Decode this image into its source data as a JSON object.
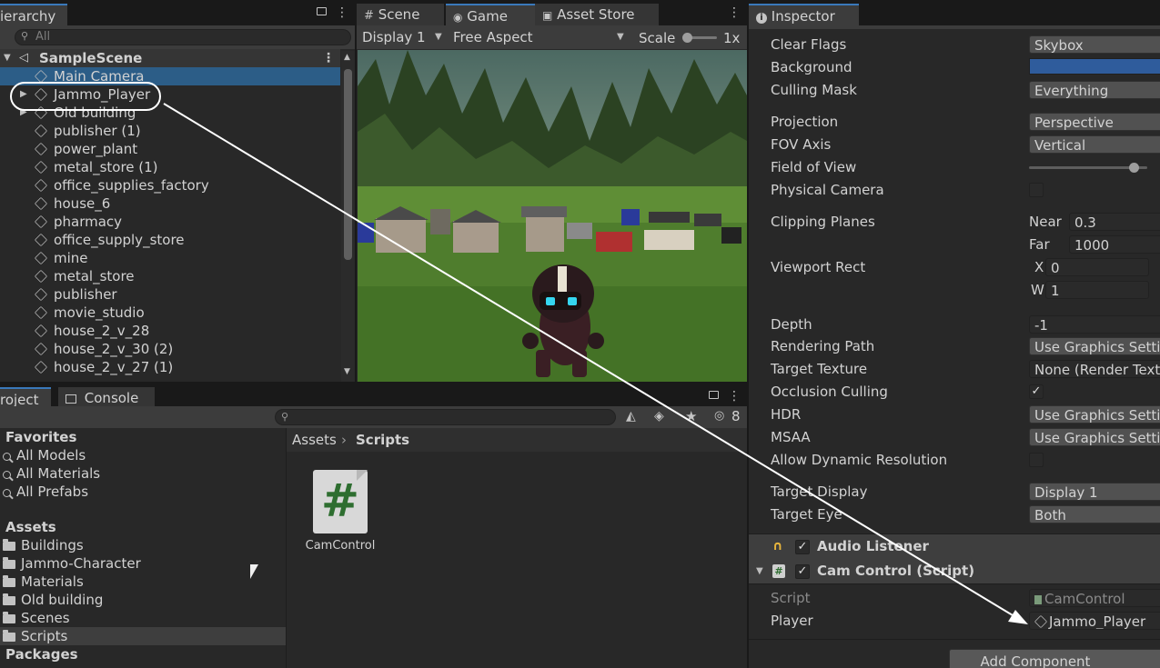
{
  "hierarchy": {
    "tab_label": "ierarchy",
    "search_placeholder": "All",
    "scene_name": "SampleScene",
    "items": [
      {
        "label": "Main Camera",
        "selected": true,
        "expandable": false
      },
      {
        "label": "Jammo_Player",
        "selected": false,
        "expandable": true
      },
      {
        "label": "Old building",
        "selected": false,
        "expandable": true
      },
      {
        "label": "publisher (1)",
        "selected": false,
        "expandable": false
      },
      {
        "label": "power_plant",
        "selected": false,
        "expandable": false
      },
      {
        "label": "metal_store (1)",
        "selected": false,
        "expandable": false
      },
      {
        "label": "office_supplies_factory",
        "selected": false,
        "expandable": false
      },
      {
        "label": "house_6",
        "selected": false,
        "expandable": false
      },
      {
        "label": "pharmacy",
        "selected": false,
        "expandable": false
      },
      {
        "label": "office_supply_store",
        "selected": false,
        "expandable": false
      },
      {
        "label": "mine",
        "selected": false,
        "expandable": false
      },
      {
        "label": "metal_store",
        "selected": false,
        "expandable": false
      },
      {
        "label": "publisher",
        "selected": false,
        "expandable": false
      },
      {
        "label": "movie_studio",
        "selected": false,
        "expandable": false
      },
      {
        "label": "house_2_v_28",
        "selected": false,
        "expandable": false
      },
      {
        "label": "house_2_v_30 (2)",
        "selected": false,
        "expandable": false
      },
      {
        "label": "house_2_v_27 (1)",
        "selected": false,
        "expandable": false
      }
    ]
  },
  "game": {
    "tabs": [
      "Scene",
      "Game",
      "Asset Store"
    ],
    "display": "Display 1",
    "aspect": "Free Aspect",
    "scale_label": "Scale",
    "scale_value": "1x"
  },
  "project": {
    "tabs": [
      "roject",
      "Console"
    ],
    "hidden_count": "8",
    "favorites_label": "Favorites",
    "favorites": [
      "All Models",
      "All Materials",
      "All Prefabs"
    ],
    "assets_label": "Assets",
    "folders": [
      "Buildings",
      "Jammo-Character",
      "Materials",
      "Old building",
      "Scenes",
      "Scripts"
    ],
    "selected_folder": "Scripts",
    "packages_label": "Packages",
    "breadcrumb": [
      "Assets",
      "Scripts"
    ],
    "files": [
      {
        "name": "CamControl",
        "glyph": "#"
      }
    ]
  },
  "inspector": {
    "tab_label": "Inspector",
    "camera_rows": {
      "clear_flags": {
        "label": "Clear Flags",
        "value": "Skybox"
      },
      "background": {
        "label": "Background",
        "color": "#2f5c9c"
      },
      "culling_mask": {
        "label": "Culling Mask",
        "value": "Everything"
      },
      "projection": {
        "label": "Projection",
        "value": "Perspective"
      },
      "fov_axis": {
        "label": "FOV Axis",
        "value": "Vertical"
      },
      "field_of_view": {
        "label": "Field of View"
      },
      "physical_camera": {
        "label": "Physical Camera",
        "checked": false
      },
      "clipping_planes": {
        "label": "Clipping Planes",
        "near_label": "Near",
        "near": "0.3",
        "far_label": "Far",
        "far": "1000"
      },
      "viewport_rect": {
        "label": "Viewport Rect",
        "x_label": "X",
        "x": "0",
        "w_label": "W",
        "w": "1"
      },
      "depth": {
        "label": "Depth",
        "value": "-1"
      },
      "rendering_path": {
        "label": "Rendering Path",
        "value": "Use Graphics Settin"
      },
      "target_texture": {
        "label": "Target Texture",
        "value": "None (Render Textu"
      },
      "occlusion_culling": {
        "label": "Occlusion Culling",
        "checked": true
      },
      "hdr": {
        "label": "HDR",
        "value": "Use Graphics Settin"
      },
      "msaa": {
        "label": "MSAA",
        "value": "Use Graphics Settin"
      },
      "allow_dynamic_resolution": {
        "label": "Allow Dynamic Resolution",
        "checked": false
      },
      "target_display": {
        "label": "Target Display",
        "value": "Display 1"
      },
      "target_eye": {
        "label": "Target Eye",
        "value": "Both"
      }
    },
    "audio_listener": {
      "label": "Audio Listener",
      "enabled": true
    },
    "cam_control": {
      "label": "Cam Control (Script)",
      "enabled": true,
      "script_label": "Script",
      "script_value": "CamControl",
      "player_label": "Player",
      "player_value": "Jammo_Player"
    },
    "add_component": "Add Component"
  },
  "colors": {
    "selection": "#2c5d87",
    "accent": "#3a79bb",
    "background_swatch": "#2f5c9c"
  }
}
